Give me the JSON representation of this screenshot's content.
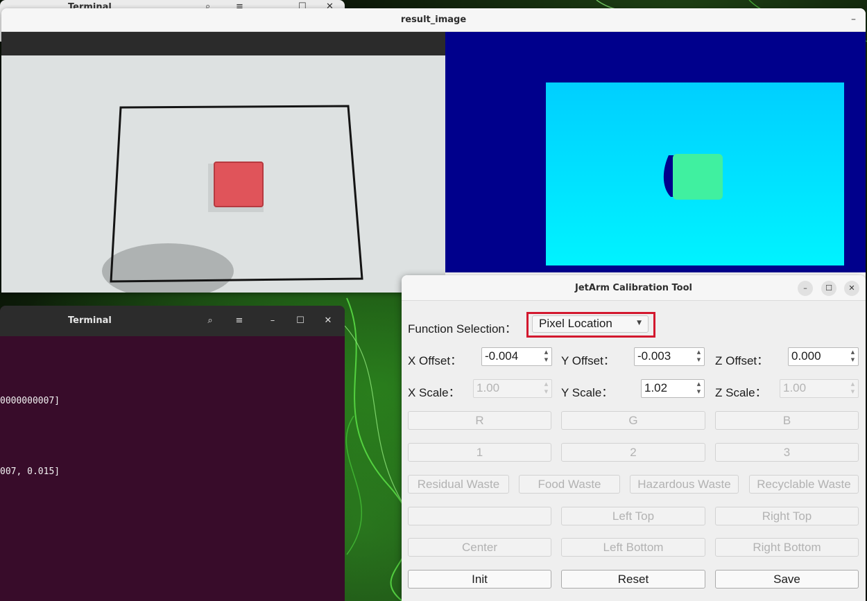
{
  "background_terminal": {
    "title": "Terminal"
  },
  "result_window": {
    "title": "result_image",
    "minimize": "–"
  },
  "terminal": {
    "title": "Terminal",
    "lines": [
      "0000000007]",
      "007, 0.015]"
    ]
  },
  "calibration_tool": {
    "title": "JetArm Calibration Tool",
    "function_selection": {
      "label": "Function Selection：",
      "value": "Pixel Location"
    },
    "offsets": {
      "x_label": "X Offset：",
      "x_value": "-0.004",
      "y_label": "Y Offset：",
      "y_value": "-0.003",
      "z_label": "Z Offset：",
      "z_value": "0.000"
    },
    "scales": {
      "x_label": "X Scale：",
      "x_value": "1.00",
      "y_label": "Y Scale：",
      "y_value": "1.02",
      "z_label": "Z Scale：",
      "z_value": "1.00"
    },
    "color_buttons": [
      "R",
      "G",
      "B"
    ],
    "number_buttons": [
      "1",
      "2",
      "3"
    ],
    "waste_buttons": [
      "Residual Waste",
      "Food Waste",
      "Hazardous Waste",
      "Recyclable Waste"
    ],
    "position_row1": [
      "",
      "Left Top",
      "Right Top"
    ],
    "position_row2": [
      "Center",
      "Left Bottom",
      "Right Bottom"
    ],
    "actions": {
      "init": "Init",
      "reset": "Reset",
      "save": "Save"
    }
  },
  "colors": {
    "highlight_box": "#d3182e",
    "terminal_bg": "#380c2a",
    "depth_background": "#00008c",
    "depth_plane": "#00e2ff",
    "depth_object": "#40f0a0",
    "cube": "#e0545a"
  }
}
